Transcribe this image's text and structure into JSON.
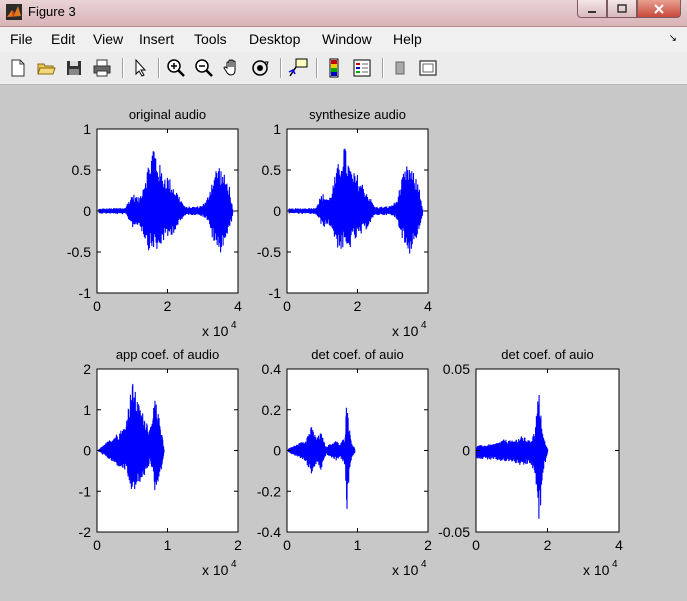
{
  "window": {
    "title": "Figure 3"
  },
  "menu": [
    "File",
    "Edit",
    "View",
    "Insert",
    "Tools",
    "Desktop",
    "Window",
    "Help"
  ],
  "toolbar_icons": [
    "new-figure-icon",
    "open-file-icon",
    "save-icon",
    "print-icon",
    "edit-plot-arrow-icon",
    "zoom-in-icon",
    "zoom-out-icon",
    "pan-hand-icon",
    "rotate-3d-icon",
    "data-cursor-icon",
    "insert-colorbar-icon",
    "insert-legend-icon",
    "hide-plot-tools-icon",
    "show-plot-tools-icon"
  ],
  "chart_data": [
    {
      "type": "line",
      "title": "original audio",
      "xlim": [
        0,
        4
      ],
      "ylim": [
        -1,
        1
      ],
      "xticks": [
        "0",
        "2",
        "4"
      ],
      "yticks": [
        "1",
        "0.5",
        "0",
        "-0.5",
        "-1"
      ],
      "x_exponent": "x 10",
      "x_exponent_power": "4",
      "color": "#0000ff",
      "envelope": {
        "x": [
          0.05,
          0.8,
          1.0,
          1.2,
          1.45,
          1.55,
          1.6,
          1.7,
          1.85,
          2.0,
          2.2,
          2.5,
          2.9,
          3.1,
          3.3,
          3.45,
          3.55,
          3.75,
          3.85
        ],
        "y_max": [
          0.03,
          0.04,
          0.22,
          0.16,
          0.58,
          0.73,
          0.88,
          0.68,
          0.48,
          0.45,
          0.3,
          0.05,
          0.06,
          0.12,
          0.46,
          0.6,
          0.5,
          0.33,
          0.02
        ],
        "y_min": [
          -0.03,
          -0.04,
          -0.2,
          -0.18,
          -0.48,
          -0.5,
          -0.45,
          -0.55,
          -0.38,
          -0.35,
          -0.25,
          -0.05,
          -0.05,
          -0.1,
          -0.4,
          -0.55,
          -0.45,
          -0.25,
          -0.02
        ]
      }
    },
    {
      "type": "line",
      "title": "synthesize audio",
      "xlim": [
        0,
        4
      ],
      "ylim": [
        -1,
        1
      ],
      "xticks": [
        "0",
        "2",
        "4"
      ],
      "yticks": [
        "1",
        "0.5",
        "0",
        "-0.5",
        "-1"
      ],
      "x_exponent": "x 10",
      "x_exponent_power": "4",
      "color": "#0000ff",
      "envelope": {
        "x": [
          0.05,
          0.8,
          1.0,
          1.2,
          1.45,
          1.55,
          1.6,
          1.7,
          1.85,
          2.0,
          2.2,
          2.5,
          2.9,
          3.1,
          3.3,
          3.45,
          3.55,
          3.75,
          3.85
        ],
        "y_max": [
          0.03,
          0.04,
          0.22,
          0.16,
          0.58,
          0.73,
          0.88,
          0.68,
          0.48,
          0.45,
          0.3,
          0.05,
          0.06,
          0.12,
          0.46,
          0.6,
          0.5,
          0.33,
          0.02
        ],
        "y_min": [
          -0.03,
          -0.04,
          -0.2,
          -0.18,
          -0.48,
          -0.5,
          -0.45,
          -0.55,
          -0.38,
          -0.35,
          -0.25,
          -0.05,
          -0.05,
          -0.1,
          -0.4,
          -0.55,
          -0.45,
          -0.25,
          -0.02
        ]
      }
    },
    {
      "type": "line",
      "title": "app coef. of audio",
      "xlim": [
        0,
        2
      ],
      "ylim": [
        -2,
        2
      ],
      "xticks": [
        "0",
        "1",
        "2"
      ],
      "yticks": [
        "2",
        "1",
        "0",
        "-1",
        "-2"
      ],
      "x_exponent": "x 10",
      "x_exponent_power": "4",
      "color": "#0000ff",
      "envelope": {
        "x": [
          0.02,
          0.3,
          0.4,
          0.5,
          0.6,
          0.72,
          0.75,
          0.78,
          0.82,
          0.92,
          0.95
        ],
        "y_max": [
          0.02,
          0.45,
          0.6,
          1.72,
          1.1,
          0.7,
          0.5,
          0.7,
          1.3,
          0.5,
          0.02
        ],
        "y_min": [
          -0.02,
          -0.4,
          -0.5,
          -1.08,
          -0.8,
          -0.5,
          -0.2,
          -0.5,
          -1.05,
          -0.4,
          -0.02
        ]
      }
    },
    {
      "type": "line",
      "title": "det coef. of auio",
      "xlim": [
        0,
        2
      ],
      "ylim": [
        -0.4,
        0.4
      ],
      "xticks": [
        "0",
        "1",
        "2"
      ],
      "yticks": [
        "0.4",
        "0.2",
        "0",
        "-0.2",
        "-0.4"
      ],
      "x_exponent": "x 10",
      "x_exponent_power": "4",
      "color": "#0000ff",
      "envelope": {
        "x": [
          0.02,
          0.25,
          0.35,
          0.42,
          0.48,
          0.55,
          0.7,
          0.75,
          0.82,
          0.85,
          0.88,
          0.92,
          0.96
        ],
        "y_max": [
          0.01,
          0.05,
          0.12,
          0.06,
          0.09,
          0.02,
          0.05,
          0.03,
          0.07,
          0.27,
          0.12,
          0.04,
          0.01
        ],
        "y_min": [
          -0.01,
          -0.05,
          -0.12,
          -0.06,
          -0.1,
          -0.02,
          -0.05,
          -0.03,
          -0.08,
          -0.33,
          -0.1,
          -0.04,
          -0.01
        ]
      }
    },
    {
      "type": "line",
      "title": "det coef. of auio",
      "xlim": [
        0,
        4
      ],
      "ylim": [
        -0.05,
        0.05
      ],
      "xticks": [
        "0",
        "2",
        "4"
      ],
      "yticks": [
        "0.05",
        "0",
        "-0.05"
      ],
      "x_exponent": "x 10",
      "x_exponent_power": "4",
      "color": "#0000ff",
      "envelope": {
        "x": [
          0.02,
          0.5,
          0.8,
          1.0,
          1.3,
          1.5,
          1.65,
          1.75,
          1.8,
          1.85,
          1.95,
          2.0
        ],
        "y_max": [
          0.003,
          0.004,
          0.007,
          0.006,
          0.009,
          0.006,
          0.012,
          0.037,
          0.03,
          0.012,
          0.004,
          0.001
        ],
        "y_min": [
          -0.005,
          -0.006,
          -0.007,
          -0.007,
          -0.01,
          -0.008,
          -0.015,
          -0.045,
          -0.035,
          -0.015,
          -0.006,
          -0.001
        ]
      }
    }
  ]
}
